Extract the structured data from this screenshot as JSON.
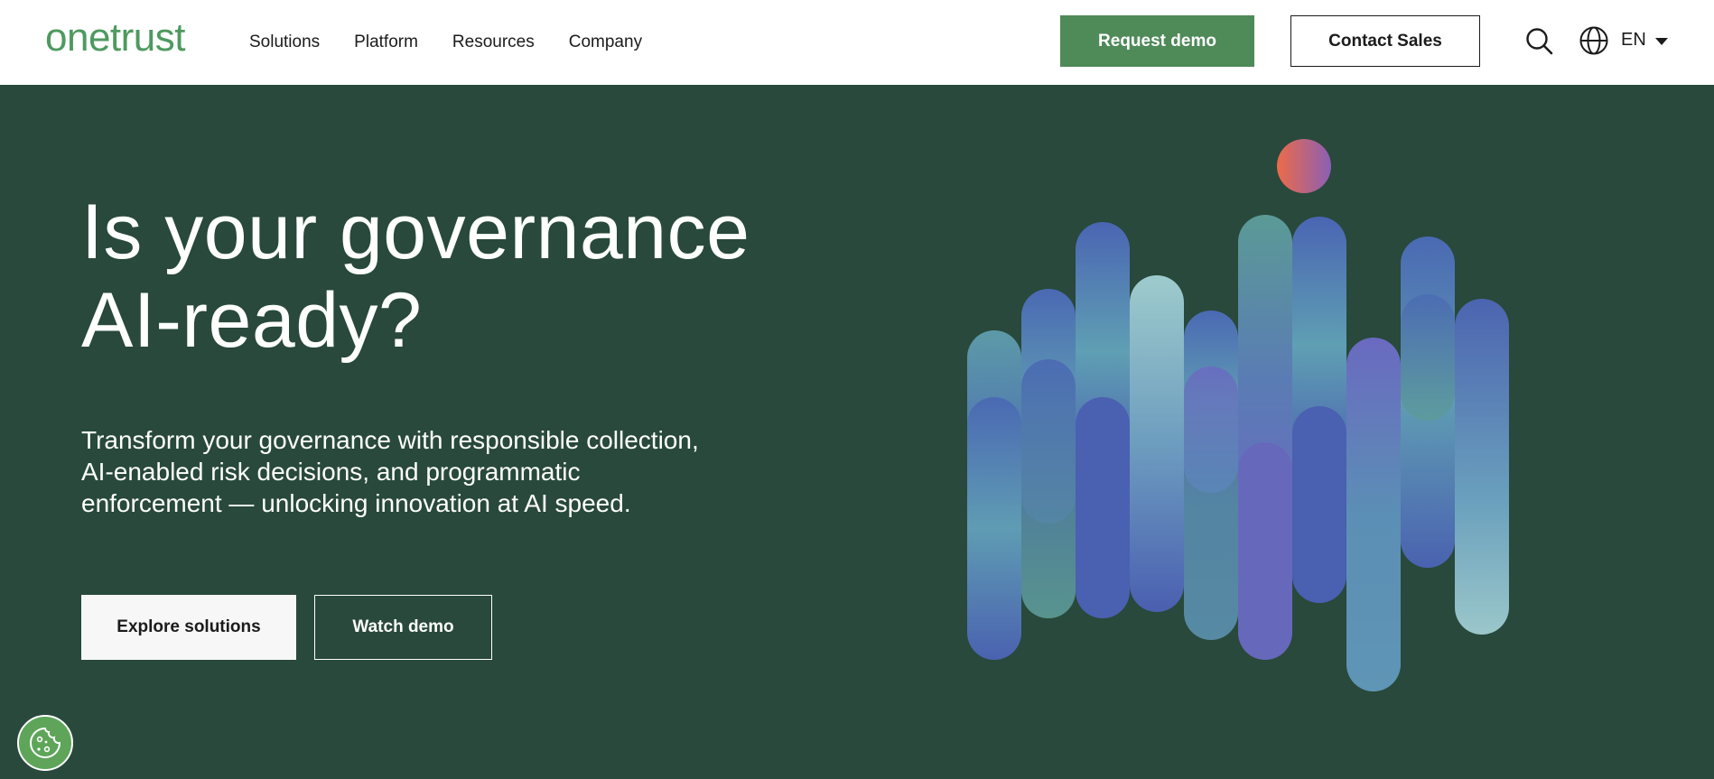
{
  "header": {
    "logo_text": "onetrust",
    "nav": [
      "Solutions",
      "Platform",
      "Resources",
      "Company"
    ],
    "request_demo_label": "Request demo",
    "contact_sales_label": "Contact Sales",
    "language": "EN"
  },
  "hero": {
    "headline_line1": "Is your governance",
    "headline_line2": "AI-ready?",
    "subtext_line1": "Transform your governance with responsible collection,",
    "subtext_line2": "AI-enabled risk decisions, and programmatic",
    "subtext_line3": "enforcement — unlocking innovation at AI speed.",
    "explore_label": "Explore solutions",
    "watch_label": "Watch demo"
  },
  "colors": {
    "brand_green": "#4e9a5f",
    "hero_background": "#28493b",
    "accent_orange": "#e8704e",
    "accent_purple": "#8b5fb0"
  },
  "icons": {
    "search": "search-icon",
    "globe": "globe-icon",
    "caret": "chevron-down-icon",
    "cookie": "cookie-icon"
  }
}
